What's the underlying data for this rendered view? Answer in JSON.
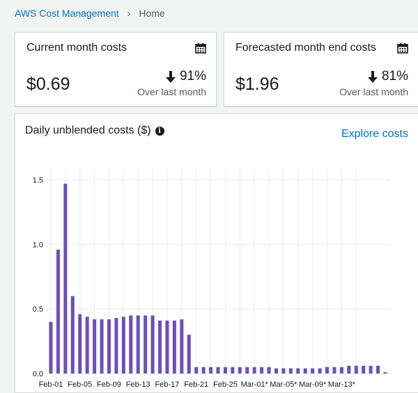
{
  "breadcrumb": {
    "root": "AWS Cost Management",
    "current": "Home"
  },
  "current_card": {
    "title": "Current month costs",
    "value": "$0.69",
    "pct": "91%",
    "sub": "Over last month",
    "icon": "calendar-icon",
    "direction": "down"
  },
  "forecast_card": {
    "title": "Forecasted month end costs",
    "value": "$1.96",
    "pct": "81%",
    "sub": "Over last month",
    "icon": "calendar-icon",
    "direction": "down"
  },
  "chart_panel": {
    "title": "Daily unblended costs ($)",
    "explore_label": "Explore costs"
  },
  "colors": {
    "bar": "#6b4fbb",
    "link": "#0073bb"
  },
  "chart_data": {
    "type": "bar",
    "title": "Daily unblended costs ($)",
    "xlabel": "",
    "ylabel": "",
    "ylim": [
      0,
      1.6
    ],
    "yticks": [
      "0.0",
      "0.5",
      "1.0",
      "1.5"
    ],
    "xtick_labels": [
      "Feb-01",
      "Feb-05",
      "Feb-09",
      "Feb-13",
      "Feb-17",
      "Feb-21",
      "Feb-25",
      "Mar-01*",
      "Mar-05*",
      "Mar-09*",
      "Mar-13*"
    ],
    "grid": true,
    "values": [
      0.4,
      0.96,
      1.47,
      0.6,
      0.46,
      0.44,
      0.42,
      0.42,
      0.42,
      0.43,
      0.44,
      0.45,
      0.45,
      0.45,
      0.45,
      0.41,
      0.41,
      0.41,
      0.42,
      0.3,
      0.05,
      0.05,
      0.05,
      0.05,
      0.05,
      0.05,
      0.05,
      0.05,
      0.05,
      0.05,
      0.05,
      0.04,
      0.04,
      0.04,
      0.04,
      0.04,
      0.04,
      0.04,
      0.05,
      0.05,
      0.05,
      0.06,
      0.06,
      0.06,
      0.06,
      0.06,
      0.01
    ]
  }
}
